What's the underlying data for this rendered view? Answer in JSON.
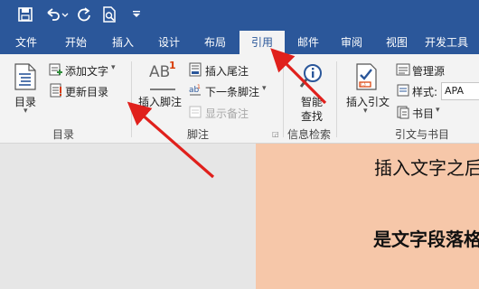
{
  "quick_access": {
    "save_icon": "save-icon",
    "undo_icon": "undo-icon",
    "redo_icon": "redo-icon",
    "print_preview_icon": "print-preview-icon",
    "customize_icon": "customize-qat-icon"
  },
  "tabs": [
    "文件",
    "开始",
    "插入",
    "设计",
    "布局",
    "引用",
    "邮件",
    "审阅",
    "视图",
    "开发工具"
  ],
  "active_tab": "引用",
  "ribbon": {
    "toc": {
      "button_label": "目录",
      "add_text": "添加文字",
      "update_toc": "更新目录",
      "group_label": "目录"
    },
    "footnotes": {
      "insert_footnote": "插入脚注",
      "insert_endnote": "插入尾注",
      "next_footnote": "下一条脚注",
      "show_notes": "显示备注",
      "group_label": "脚注",
      "superscript": "AB",
      "superscript_num": "1"
    },
    "research": {
      "smart_lookup_line1": "智能",
      "smart_lookup_line2": "查找",
      "group_label": "信息检索"
    },
    "citations": {
      "insert_citation": "插入引文",
      "manage_sources": "管理源",
      "style_label": "样式:",
      "style_value": "APA",
      "bibliography": "书目",
      "group_label": "引文与书目"
    }
  },
  "document": {
    "line1": "插入文字之后",
    "line2": "是文字段落格式"
  },
  "colors": {
    "ribbon_blue": "#2b579a",
    "arrow_red": "#e0201c",
    "page_color": "#f6c7a9"
  }
}
